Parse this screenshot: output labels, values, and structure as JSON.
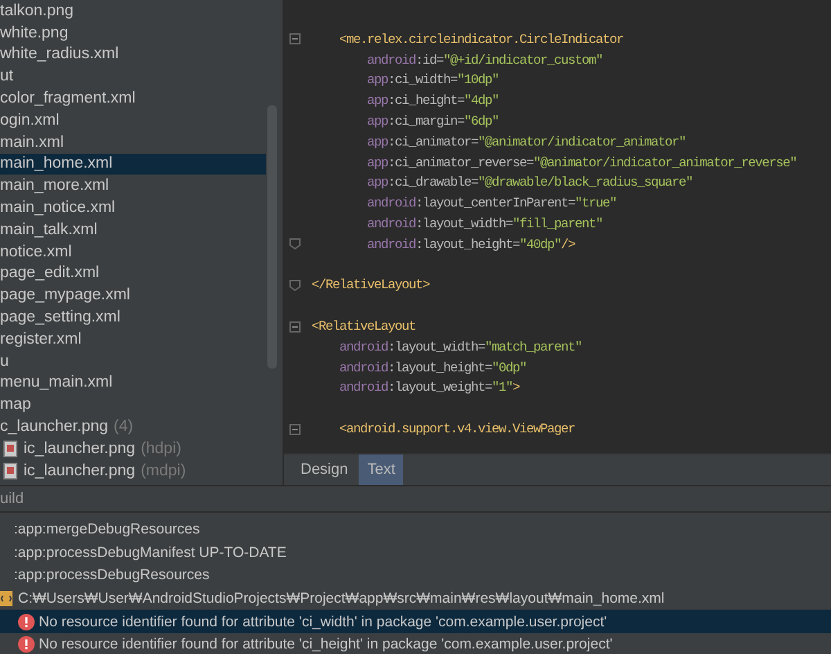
{
  "project_tree": {
    "items": [
      {
        "label": "talkon.png",
        "selected": false
      },
      {
        "label": "white.png",
        "selected": false
      },
      {
        "label": "white_radius.xml",
        "selected": false
      },
      {
        "label": "ut",
        "selected": false
      },
      {
        "label": "color_fragment.xml",
        "selected": false
      },
      {
        "label": "ogin.xml",
        "selected": false
      },
      {
        "label": "main.xml",
        "selected": false
      },
      {
        "label": "main_home.xml",
        "selected": true
      },
      {
        "label": "main_more.xml",
        "selected": false
      },
      {
        "label": "main_notice.xml",
        "selected": false
      },
      {
        "label": "main_talk.xml",
        "selected": false
      },
      {
        "label": "notice.xml",
        "selected": false
      },
      {
        "label": "page_edit.xml",
        "selected": false
      },
      {
        "label": "page_mypage.xml",
        "selected": false
      },
      {
        "label": "page_setting.xml",
        "selected": false
      },
      {
        "label": "register.xml",
        "selected": false
      },
      {
        "label": "u",
        "selected": false
      },
      {
        "label": "menu_main.xml",
        "selected": false
      },
      {
        "label": "map",
        "selected": false
      },
      {
        "label": "c_launcher.png",
        "note": "(4)",
        "selected": false,
        "children": [
          {
            "label": "ic_launcher.png",
            "note": "(hdpi)",
            "selected": false
          },
          {
            "label": "ic_launcher.png",
            "note": "(mdpi)",
            "selected": false
          }
        ]
      }
    ]
  },
  "editor": {
    "lines": [
      {
        "fold_start": true,
        "tag": "    <me.relex.circleindicator.CircleIndicator"
      },
      {
        "namespace": "        android",
        "attribute": ":id=",
        "value": "\"@+id/indicator_custom\""
      },
      {
        "namespace": "        app",
        "attribute": ":ci_width=",
        "value": "\"10dp\""
      },
      {
        "namespace": "        app",
        "attribute": ":ci_height=",
        "value": "\"4dp\""
      },
      {
        "namespace": "        app",
        "attribute": ":ci_margin=",
        "value": "\"6dp\""
      },
      {
        "namespace": "        app",
        "attribute": ":ci_animator=",
        "value": "\"@animator/indicator_animator\""
      },
      {
        "namespace": "        app",
        "attribute": ":ci_animator_reverse=",
        "value": "\"@animator/indicator_animator_reverse\""
      },
      {
        "namespace": "        app",
        "attribute": ":ci_drawable=",
        "value": "\"@drawable/black_radius_square\""
      },
      {
        "namespace": "        android",
        "attribute": ":layout_centerInParent=",
        "value": "\"true\""
      },
      {
        "namespace": "        android",
        "attribute": ":layout_width=",
        "value": "\"fill_parent\""
      },
      {
        "fold_end": true,
        "namespace": "        android",
        "attribute": ":layout_height=",
        "value": "\"40dp\"",
        "tag_end": "/>"
      },
      {
        "spaced_before": true,
        "fold_end": true,
        "tag": "</RelativeLayout>"
      },
      {
        "spaced_before": true,
        "fold_start": true,
        "tag": "<RelativeLayout"
      },
      {
        "namespace": "    android",
        "attribute": ":layout_width=",
        "value": "\"match_parent\""
      },
      {
        "namespace": "    android",
        "attribute": ":layout_height=",
        "value": "\"0dp\""
      },
      {
        "namespace": "    android",
        "attribute": ":layout_weight=",
        "value": "\"1\"",
        "tag_end": ">"
      },
      {
        "spaced_before": true,
        "fold_start": true,
        "tag": "    <android.support.v4.view.ViewPager"
      }
    ],
    "tabs": [
      {
        "label": "Design",
        "selected": false
      },
      {
        "label": "Text",
        "selected": true
      }
    ]
  },
  "build": {
    "title": "uild",
    "rows": [
      {
        "kind": "task",
        "text": ":app:mergeDebugResources",
        "selected": false
      },
      {
        "kind": "task",
        "text": ":app:processDebugManifest UP-TO-DATE",
        "selected": false
      },
      {
        "kind": "task",
        "text": ":app:processDebugResources",
        "selected": false
      },
      {
        "kind": "file",
        "text": "C:₩Users₩User₩AndroidStudioProjects₩Project₩app₩src₩main₩res₩layout₩main_home.xml",
        "selected": false
      },
      {
        "kind": "error",
        "text": "No resource identifier found for attribute 'ci_width' in package 'com.example.user.project'",
        "selected": true
      },
      {
        "kind": "error",
        "text": "No resource identifier found for attribute 'ci_height' in package 'com.example.user.project'",
        "selected": false
      }
    ]
  }
}
